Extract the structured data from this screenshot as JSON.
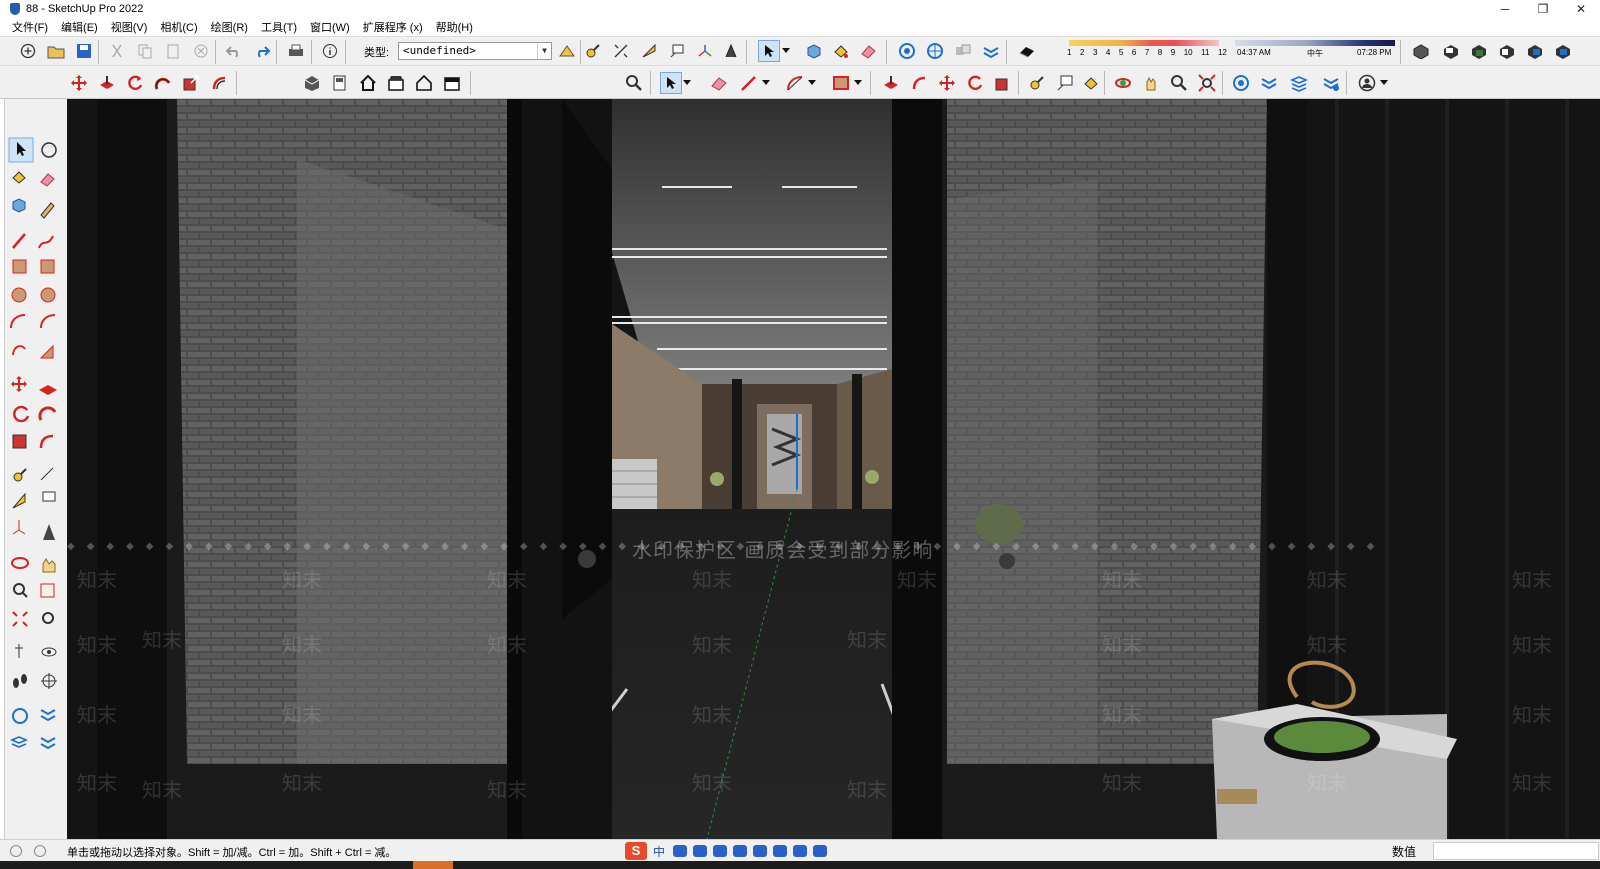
{
  "window": {
    "title": "88 - SketchUp Pro 2022",
    "minimize": "─",
    "restore": "❐",
    "close": "✕"
  },
  "menu": [
    "文件(F)",
    "编辑(E)",
    "视图(V)",
    "相机(C)",
    "绘图(R)",
    "工具(T)",
    "窗口(W)",
    "扩展程序 (x)",
    "帮助(H)"
  ],
  "type_field": {
    "label": "类型:",
    "value": "<undefined>"
  },
  "shadow_months": [
    "1",
    "2",
    "3",
    "4",
    "5",
    "6",
    "7",
    "8",
    "9",
    "10",
    "11",
    "12"
  ],
  "time": {
    "start": "04:37 AM",
    "mid": "中午",
    "end": "07:28 PM"
  },
  "viewport": {
    "watermark": "水印保护区  画质会受到部分影响",
    "tile_text": "知末"
  },
  "status": {
    "hint": "单击或拖动以选择对象。Shift = 加/减。Ctrl = 加。Shift + Ctrl = 减。",
    "measurements_label": "数值",
    "ime_zh": "中"
  },
  "colors": {
    "accent_blue": "#1a6fd1",
    "accent_red": "#d5231f",
    "viewport_bg": "#151515"
  }
}
